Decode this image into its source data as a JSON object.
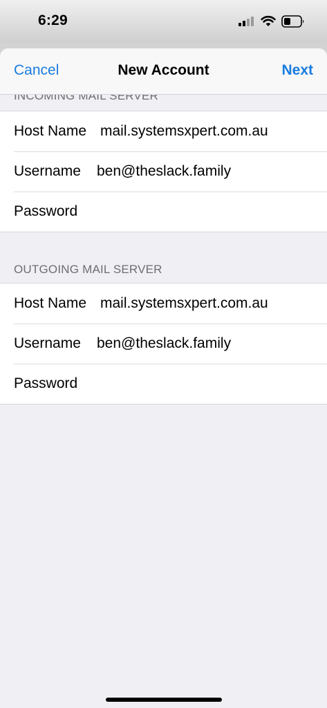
{
  "status_bar": {
    "time": "6:29"
  },
  "nav": {
    "cancel_label": "Cancel",
    "title": "New Account",
    "next_label": "Next"
  },
  "incoming": {
    "header": "INCOMING MAIL SERVER",
    "host_label": "Host Name",
    "host_value": "mail.systemsxpert.com.au",
    "username_label": "Username",
    "username_value": "ben@theslack.family",
    "password_label": "Password",
    "password_value": ""
  },
  "outgoing": {
    "header": "OUTGOING MAIL SERVER",
    "host_label": "Host Name",
    "host_value": "mail.systemsxpert.com.au",
    "username_label": "Username",
    "username_value": "ben@theslack.family",
    "password_label": "Password",
    "password_value": ""
  },
  "colors": {
    "accent": "#1a7ce0",
    "background": "#efeff4",
    "header_text": "#6d6d72"
  },
  "icons": {
    "signal": "cellular-signal-icon",
    "wifi": "wifi-icon",
    "battery": "battery-icon"
  }
}
